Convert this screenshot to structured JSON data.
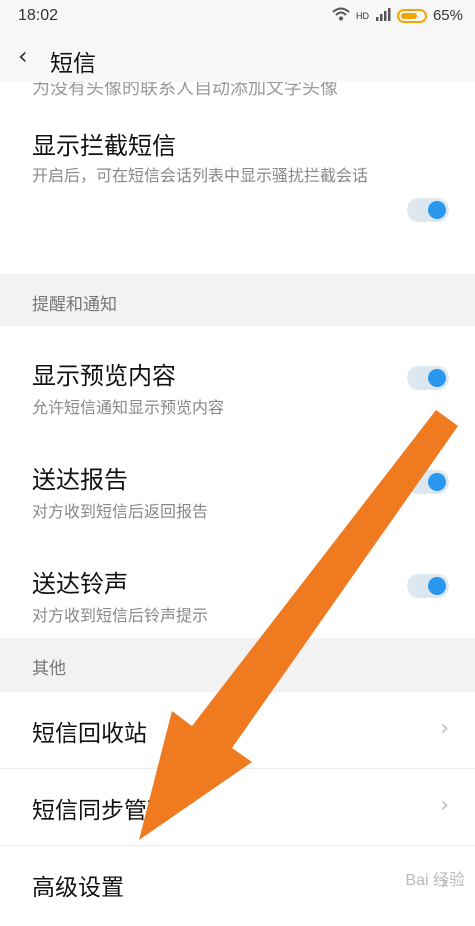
{
  "status_bar": {
    "time": "18:02",
    "network": "HD",
    "battery_text": "65%",
    "battery_level": 0.65
  },
  "header": {
    "back_icon": "chevron-left-icon",
    "title": "短信"
  },
  "items": {
    "avatar_desc": "为没有头像的联系人自动添加文字头像",
    "show_blocked": {
      "title": "显示拦截短信",
      "subtitle": "开启后，可在短信会话列表中显示骚扰拦截会话",
      "toggle_on": true
    },
    "section_notify": "提醒和通知",
    "preview": {
      "title": "显示预览内容",
      "subtitle": "允许短信通知显示预览内容",
      "toggle_on": true
    },
    "delivery_report": {
      "title": "送达报告",
      "subtitle": "对方收到短信后返回报告",
      "toggle_on": true
    },
    "delivery_tone": {
      "title": "送达铃声",
      "subtitle": "对方收到短信后铃声提示",
      "toggle_on": true
    },
    "section_other": "其他",
    "recycle_bin": {
      "title": "短信回收站"
    },
    "sync": {
      "title": "短信同步管理"
    },
    "advanced": {
      "title": "高级设置"
    }
  },
  "overlay": {
    "annotation": "orange-arrow-pointing-to-advanced-settings",
    "color": "#f07a20"
  },
  "watermark": "Bai 经验"
}
